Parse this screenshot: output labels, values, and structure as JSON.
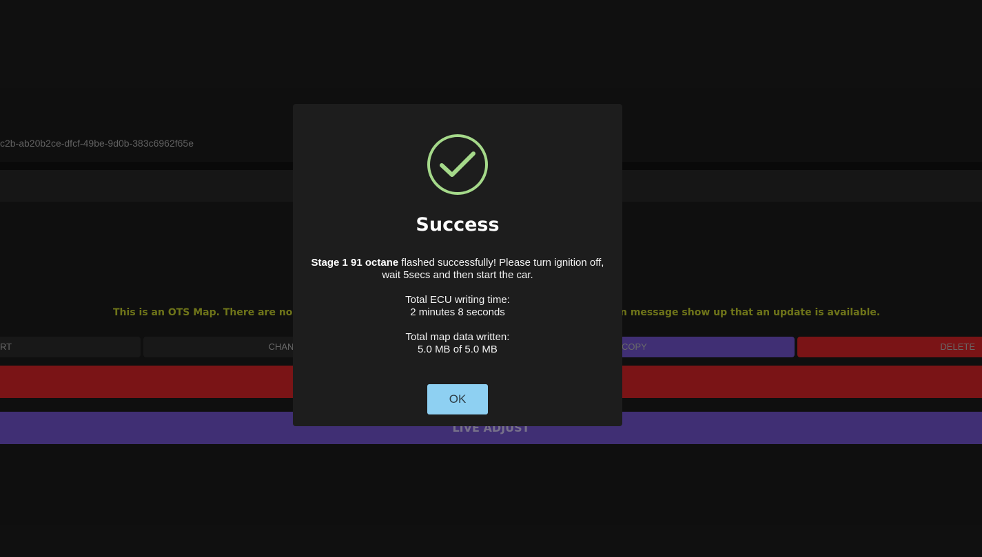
{
  "background": {
    "uuid_text": "c2b-ab20b2ce-dfcf-49be-9d0b-383c6962f65e",
    "notice_left": "This is an OTS Map. There are no update",
    "notice_right": "n message show up that an update is available.",
    "buttons": {
      "start_label": "RT",
      "change_label": "CHAN",
      "copy_label": "COPY",
      "delete_label": "DELETE",
      "live_adjust_label": "LIVE ADJUST"
    }
  },
  "modal": {
    "icon": "check-circle-icon",
    "title": "Success",
    "map_name": "Stage 1 91 octane",
    "message": " flashed successfully! Please turn ignition off, wait 5secs and then start the car.",
    "write_time_label": "Total ECU writing time:",
    "write_time_value": "2 minutes 8 seconds",
    "data_written_label": "Total map data written:",
    "data_written_value": "5.0 MB of 5.0 MB",
    "ok_label": "OK"
  },
  "colors": {
    "success_green": "#a5d98a",
    "ok_button": "#8ed0f2",
    "delete_red": "#cc2226",
    "purple": "#6b4fc1",
    "notice_yellow": "#b8c22a"
  }
}
